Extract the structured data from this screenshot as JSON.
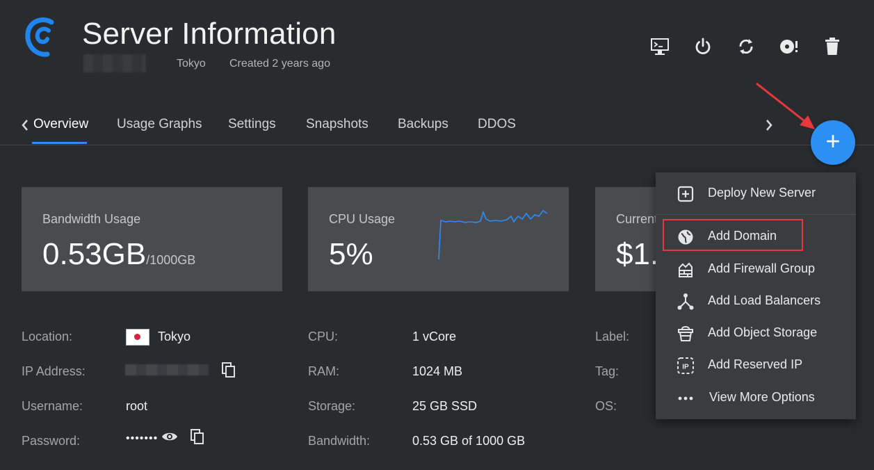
{
  "header": {
    "title": "Server Information",
    "location": "Tokyo",
    "created": "Created 2 years ago"
  },
  "toolbar": {
    "icons": [
      "console-icon",
      "power-icon",
      "restart-icon",
      "reinstall-icon",
      "trash-icon"
    ]
  },
  "tabs": [
    {
      "label": "Overview",
      "active": true
    },
    {
      "label": "Usage Graphs"
    },
    {
      "label": "Settings"
    },
    {
      "label": "Snapshots"
    },
    {
      "label": "Backups"
    },
    {
      "label": "DDOS"
    }
  ],
  "cards": {
    "bandwidth": {
      "label": "Bandwidth Usage",
      "value": "0.53GB",
      "sub": "/1000GB"
    },
    "cpu": {
      "label": "CPU Usage",
      "value": "5%"
    },
    "charges": {
      "label": "Current",
      "value": "$1."
    }
  },
  "info": {
    "col1": [
      {
        "label": "Location:",
        "value": "Tokyo"
      },
      {
        "label": "IP Address:",
        "value": ""
      },
      {
        "label": "Username:",
        "value": "root"
      },
      {
        "label": "Password:",
        "value": "•••••••"
      }
    ],
    "col2": [
      {
        "label": "CPU:",
        "value": "1 vCore"
      },
      {
        "label": "RAM:",
        "value": "1024 MB"
      },
      {
        "label": "Storage:",
        "value": "25 GB SSD"
      },
      {
        "label": "Bandwidth:",
        "value": "0.53 GB of 1000 GB"
      }
    ],
    "col3": [
      {
        "label": "Label:"
      },
      {
        "label": "Tag:"
      },
      {
        "label": "OS:"
      }
    ]
  },
  "fab": {
    "label": "+"
  },
  "menu": {
    "items": [
      {
        "label": "Deploy New Server",
        "icon": "plus-square-icon"
      },
      {
        "label": "Add Domain",
        "icon": "globe-icon"
      },
      {
        "label": "Add Firewall Group",
        "icon": "firewall-icon"
      },
      {
        "label": "Add Load Balancers",
        "icon": "load-balancer-icon"
      },
      {
        "label": "Add Object Storage",
        "icon": "bucket-icon"
      },
      {
        "label": "Add Reserved IP",
        "icon": "reserved-ip-icon"
      },
      {
        "label": "View More Options",
        "icon": "more-dots-icon"
      }
    ],
    "reserved_ip_icon_text": "IP"
  },
  "colors": {
    "accent": "#2f8cf5",
    "background": "#2a2b2f",
    "card": "#4a4b4f",
    "menu": "#3b3c40",
    "annotation": "#e5393d"
  }
}
